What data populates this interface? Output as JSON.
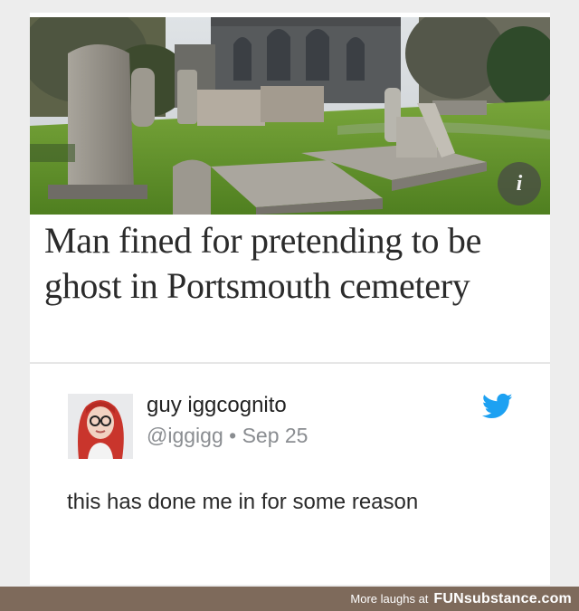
{
  "article": {
    "headline": "Man fined for pretending to be ghost in Portsmouth cemetery",
    "photo_icon": "cemetery-photo",
    "info_label": "i"
  },
  "tweet": {
    "display_name": "guy iggcognito",
    "handle": "@iggigg",
    "separator": "•",
    "date": "Sep 25",
    "meta": "@iggigg • Sep 25",
    "text": "this has done me in for some reason",
    "avatar_icon": "red-haired-person-avatar",
    "service_icon": "twitter-bird-icon"
  },
  "footer": {
    "tagline": "More laughs at",
    "brand": "FUNsubstance.com"
  },
  "colors": {
    "twitter_blue": "#1da1f2",
    "footer_bar": "#7e6a5b",
    "grass": "#5f8e2a"
  }
}
